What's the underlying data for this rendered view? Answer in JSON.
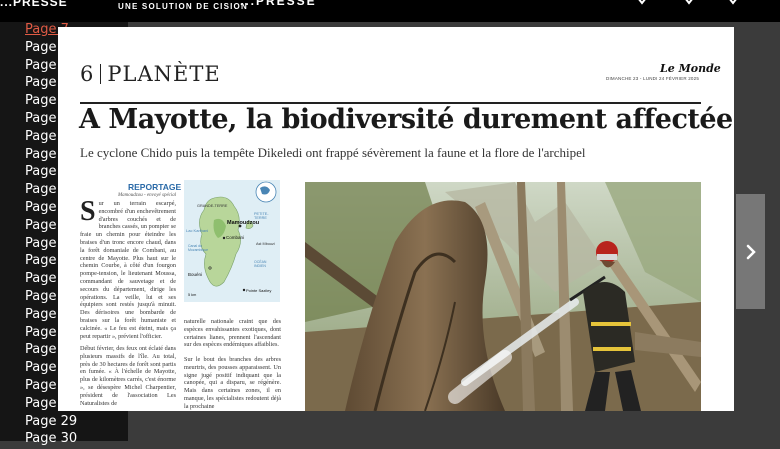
{
  "topbar": {
    "brand_left": "...PRESSE",
    "tagline": "UNE SOLUTION DE CISION",
    "brand_right": "...PRESSE"
  },
  "sidebar": {
    "pages": [
      "Page 7",
      "Page 8",
      "Page 9",
      "Page 10",
      "Page 11",
      "Page 12",
      "Page 13",
      "Page 14",
      "Page 15",
      "Page 16",
      "Page 17",
      "Page 18",
      "Page 19",
      "Page 20",
      "Page 21",
      "Page 22",
      "Page 23",
      "Page 24",
      "Page 25",
      "Page 26",
      "Page 27",
      "Page 28",
      "Page 29",
      "Page 30"
    ],
    "active_page": "Page 7"
  },
  "article": {
    "section_number": "6",
    "section_name": "PLANÈTE",
    "masthead": "Le Monde",
    "dateline": "DIMANCHE 23 - LUNDI 24 FÉVRIER 2025",
    "headline": "A Mayotte, la biodiversité durement affectée",
    "subhead": "Le cyclone Chido puis la tempête Dikeledi ont frappé sévèrement la faune et la flore de l'archipel",
    "kicker": "REPORTAGE",
    "byline": "Mamoudzou - envoyé spécial",
    "dropcap": "S",
    "col1_text": "ur un terrain escarpé, encombré d'un enchevêtrement d'arbres couchés et de branches cassés, un pompier se fraie un chemin pour éteindre les braises d'un tronc encore chaud, dans la forêt domaniale de Combani, au centre de Mayotte. Plus haut sur le chemin Courbe, à côté d'un fourgon pompe-tension, le lieutenant Moussa, commandant de sauvetage et de secours du département, dirige les opérations. La veille, lui et ses équipiers sont restés jusqu'à minuit. Des dérisoires une bombarde de braises sur la forêt humaniste et calcinée. « Le feu est éteint, mais ça peut repartir », prévient l'officier.",
    "col1b_text": "Début février, des feux ont éclaté dans plusieurs massifs de l'île. Au total, près de 30 hectares de forêt sont partis en fumée. « À l'échelle de Mayotte, plus de kilomètres carrés, c'est énorme », se désespère Michel Charpentier, président de l'association Les Naturalistes de",
    "col2_text": "naturelle nationale craint que des espèces envahissantes exotiques, dont certaines lianes, prennent l'ascendant sur des espèces endémiques affaiblies.",
    "col2b_text": "Sur le bout des branches des arbres meurtris, des pousses apparaissent. Un signe jugé positif indiquant que la canopée, qui a disparu, se régénère. Mais dans certaines zones, il en manque, les spécialistes redoutent déjà la prochaine"
  },
  "map": {
    "labels": [
      "GRANDE-TERRE",
      "Mamoudzou",
      "PETITE-TERRE",
      "Lac Karihani",
      "Combani",
      "Ast Mbouzi",
      "Canal du Mozambique",
      "OCÉAN INDIEN",
      "Bouéni",
      "Pointe Saziley",
      "5 km"
    ]
  },
  "nav": {
    "next_icon": "chevron-right-icon"
  }
}
